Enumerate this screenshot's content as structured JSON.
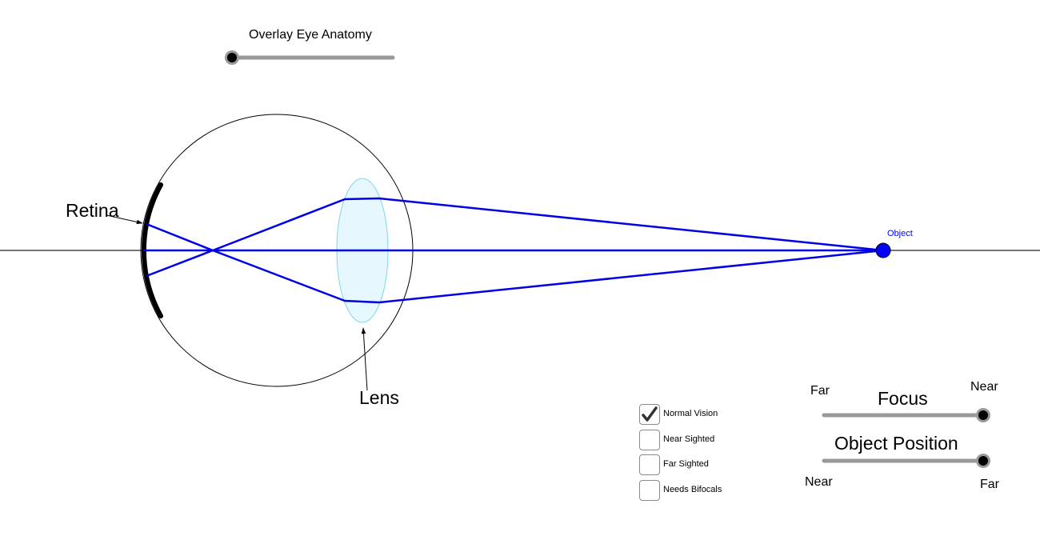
{
  "overlay_slider": {
    "label": "Overlay Eye Anatomy",
    "value": 0
  },
  "diagram": {
    "retina_label": "Retina",
    "lens_label": "Lens",
    "object_label": "Object",
    "ray_color": "#0000e6",
    "lens_fill": "#e6f7fd",
    "lens_stroke": "#7fd4f0",
    "object_color": "#0000ff",
    "axis_color": "#777777"
  },
  "vision_options": [
    {
      "label": "Normal Vision",
      "checked": true
    },
    {
      "label": "Near Sighted",
      "checked": false
    },
    {
      "label": "Far Sighted",
      "checked": false
    },
    {
      "label": "Needs Bifocals",
      "checked": false
    }
  ],
  "focus_slider": {
    "title": "Focus",
    "min_label": "Far",
    "max_label": "Near",
    "value": 1
  },
  "object_position_slider": {
    "title": "Object Position",
    "min_label": "Near",
    "max_label": "Far",
    "value": 1
  }
}
